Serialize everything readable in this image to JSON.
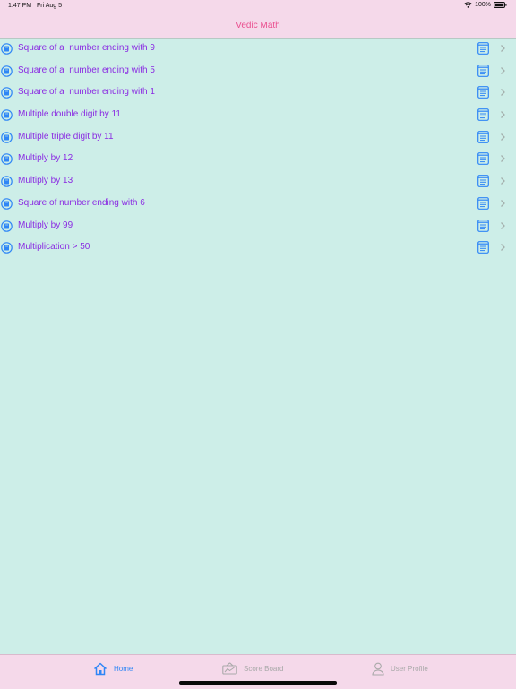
{
  "status_bar": {
    "time": "1:47 PM",
    "date": "Fri Aug 5",
    "battery": "100%",
    "icons": [
      "wifi-icon",
      "battery-icon"
    ]
  },
  "nav": {
    "title": "Vedic Math"
  },
  "list": {
    "items": [
      {
        "label": "Square of a  number ending with 9"
      },
      {
        "label": "Square of a  number ending with 5"
      },
      {
        "label": "Square of a  number ending with 1"
      },
      {
        "label": "Multiple double digit by 11"
      },
      {
        "label": "Multiple triple digit by 11"
      },
      {
        "label": "Multiply by 12"
      },
      {
        "label": "Multiply by 13"
      },
      {
        "label": "Square of number ending with 6"
      },
      {
        "label": "Multiply by 99"
      },
      {
        "label": "Multiplication > 50"
      }
    ],
    "row_icons": [
      "book-circle-icon",
      "document-icon",
      "chevron-right-icon"
    ]
  },
  "tab_bar": {
    "tabs": [
      {
        "label": "Home",
        "icon": "home-icon",
        "selected": true
      },
      {
        "label": "Score Board",
        "icon": "scoreboard-icon",
        "selected": false
      },
      {
        "label": "User Profile",
        "icon": "user-icon",
        "selected": false
      }
    ]
  },
  "colors": {
    "background": "#cdeee8",
    "bars": "#f5d9ea",
    "title": "#ea4f8f",
    "item_text": "#8a2be2",
    "accent": "#2f86f6",
    "inactive": "#a9a9a9"
  }
}
